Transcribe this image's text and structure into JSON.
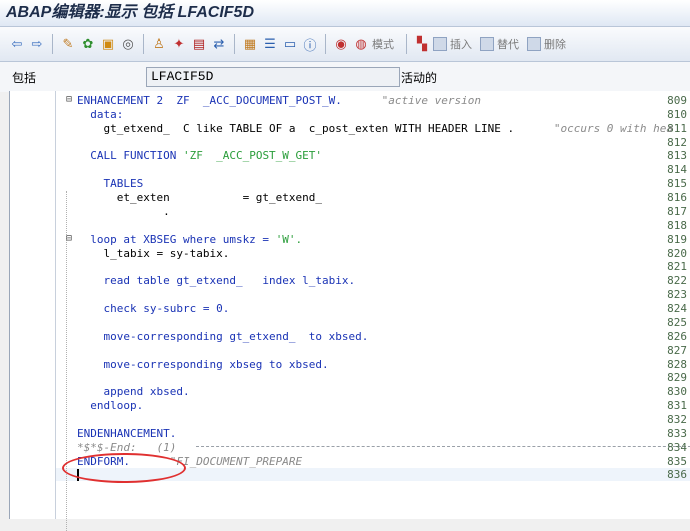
{
  "window": {
    "title": "ABAP编辑器:显示 包括 LFACIF5D"
  },
  "toolbar": {
    "icons": [
      "back-icon",
      "forward-icon",
      "other-object-icon",
      "display-change-icon",
      "active-inactive-icon",
      "other-icon",
      "check-icon",
      "activate-icon",
      "test-icon",
      "where-used-icon",
      "object-list-icon",
      "navigation-icon",
      "display-object-icon",
      "info-icon",
      "breakpoint-icon",
      "watchpoint-icon"
    ],
    "mode_label": "模式",
    "insert_label": "插入",
    "replace_label": "替代",
    "delete_label": "删除"
  },
  "info": {
    "include_label": "包括",
    "include_value": "LFACIF5D",
    "status": "活动的"
  },
  "editor": {
    "lines": [
      {
        "no": "809",
        "text": "ENHANCEMENT 2  ZF  _ACC_DOCUMENT_POST_W.",
        "comment": "\"active version"
      },
      {
        "no": "810",
        "text": "  data:",
        "comment": ""
      },
      {
        "no": "811",
        "text": "    gt_etxend_  C like TABLE OF a  c_post_exten WITH HEADER LINE .",
        "comment": "\"occurs 0 with hea"
      },
      {
        "no": "812",
        "text": "",
        "comment": ""
      },
      {
        "no": "813",
        "text": "  CALL FUNCTION 'ZF  _ACC_POST_W_GET'",
        "comment": ""
      },
      {
        "no": "814",
        "text": "",
        "comment": ""
      },
      {
        "no": "815",
        "text": "    TABLES",
        "comment": ""
      },
      {
        "no": "816",
        "text": "      et_exten           = gt_etxend_",
        "comment": ""
      },
      {
        "no": "817",
        "text": "             .",
        "comment": ""
      },
      {
        "no": "818",
        "text": "",
        "comment": ""
      },
      {
        "no": "819",
        "text": "  loop at XBSEG where umskz = 'W'.",
        "comment": ""
      },
      {
        "no": "820",
        "text": "    l_tabix = sy-tabix.",
        "comment": ""
      },
      {
        "no": "821",
        "text": "",
        "comment": ""
      },
      {
        "no": "822",
        "text": "    read table gt_etxend_   index l_tabix.",
        "comment": ""
      },
      {
        "no": "823",
        "text": "",
        "comment": ""
      },
      {
        "no": "824",
        "text": "    check sy-subrc = 0.",
        "comment": ""
      },
      {
        "no": "825",
        "text": "",
        "comment": ""
      },
      {
        "no": "826",
        "text": "    move-corresponding gt_etxend_  to xbsed.",
        "comment": ""
      },
      {
        "no": "827",
        "text": "",
        "comment": ""
      },
      {
        "no": "828",
        "text": "    move-corresponding xbseg to xbsed.",
        "comment": ""
      },
      {
        "no": "829",
        "text": "",
        "comment": ""
      },
      {
        "no": "830",
        "text": "    append xbsed.",
        "comment": ""
      },
      {
        "no": "831",
        "text": "  endloop.",
        "comment": ""
      },
      {
        "no": "832",
        "text": "",
        "comment": ""
      },
      {
        "no": "833",
        "text": "ENDENHANCEMENT.",
        "comment": ""
      },
      {
        "no": "834",
        "text": "",
        "comment": "*$*$-End:   (1)"
      },
      {
        "no": "835",
        "text": "ENDFORM.",
        "comment": "\"FI_DOCUMENT_PREPARE"
      },
      {
        "no": "836",
        "text": "",
        "comment": ""
      }
    ]
  }
}
